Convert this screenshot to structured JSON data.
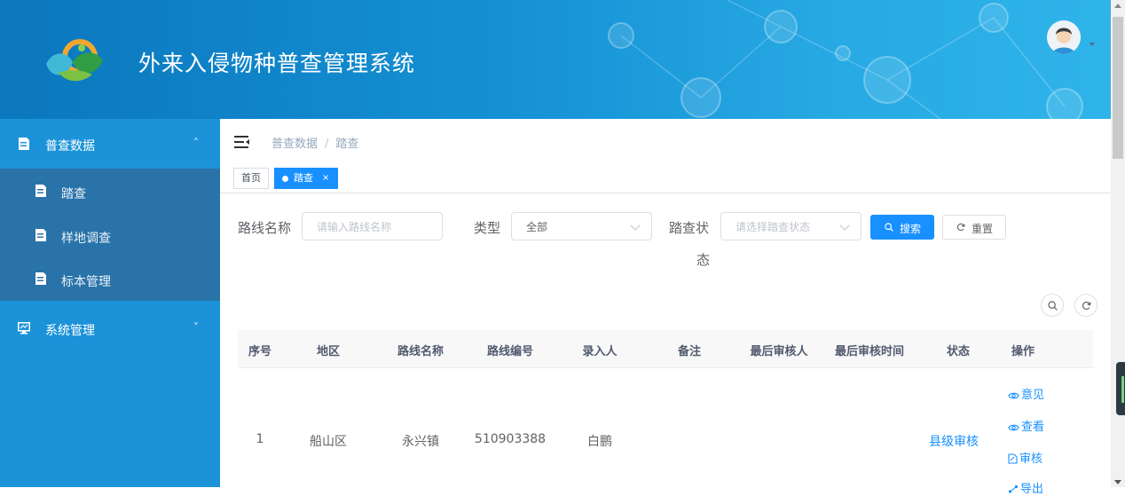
{
  "header": {
    "title": "外来入侵物种普查管理系统",
    "colors": {
      "header_start": "#0b77bd",
      "header_end": "#2fb4ea",
      "sidebar": "#1c93d8",
      "submenu": "#2a73a8",
      "accent": "#1890ff"
    }
  },
  "sidebar": {
    "groups": [
      {
        "label": "普查数据",
        "icon": "document-icon",
        "expanded": true,
        "items": [
          {
            "label": "踏查",
            "icon": "document-icon"
          },
          {
            "label": "样地调查",
            "icon": "document-icon"
          },
          {
            "label": "标本管理",
            "icon": "document-icon"
          }
        ]
      },
      {
        "label": "系统管理",
        "icon": "monitor-icon",
        "expanded": false
      }
    ]
  },
  "breadcrumb": [
    "普查数据",
    "踏查"
  ],
  "breadcrumb_separator": "/",
  "tabs": [
    {
      "label": "首页",
      "active": false
    },
    {
      "label": "踏查",
      "active": true,
      "close": "×"
    }
  ],
  "search_form": {
    "route_name": {
      "label": "路线名称",
      "placeholder": "请输入路线名称"
    },
    "type": {
      "label": "类型",
      "value": "全部"
    },
    "status": {
      "label_line1": "踏查状",
      "label_line2": "态",
      "placeholder": "请选择踏查状态"
    },
    "search_button": "搜索",
    "reset_button": "重置"
  },
  "table": {
    "columns": [
      "序号",
      "地区",
      "路线名称",
      "路线编号",
      "录入人",
      "备注",
      "最后审核人",
      "最后审核时间",
      "状态",
      "操作"
    ],
    "rows": [
      {
        "index": "1",
        "region": "船山区",
        "route_name": "永兴镇",
        "route_code": "510903388",
        "entered_by": "白鹏",
        "remark": "",
        "last_reviewer": "",
        "last_review_time": "",
        "status": "县级审核",
        "actions": [
          "意见",
          "查看",
          "审核",
          "导出"
        ]
      }
    ]
  }
}
